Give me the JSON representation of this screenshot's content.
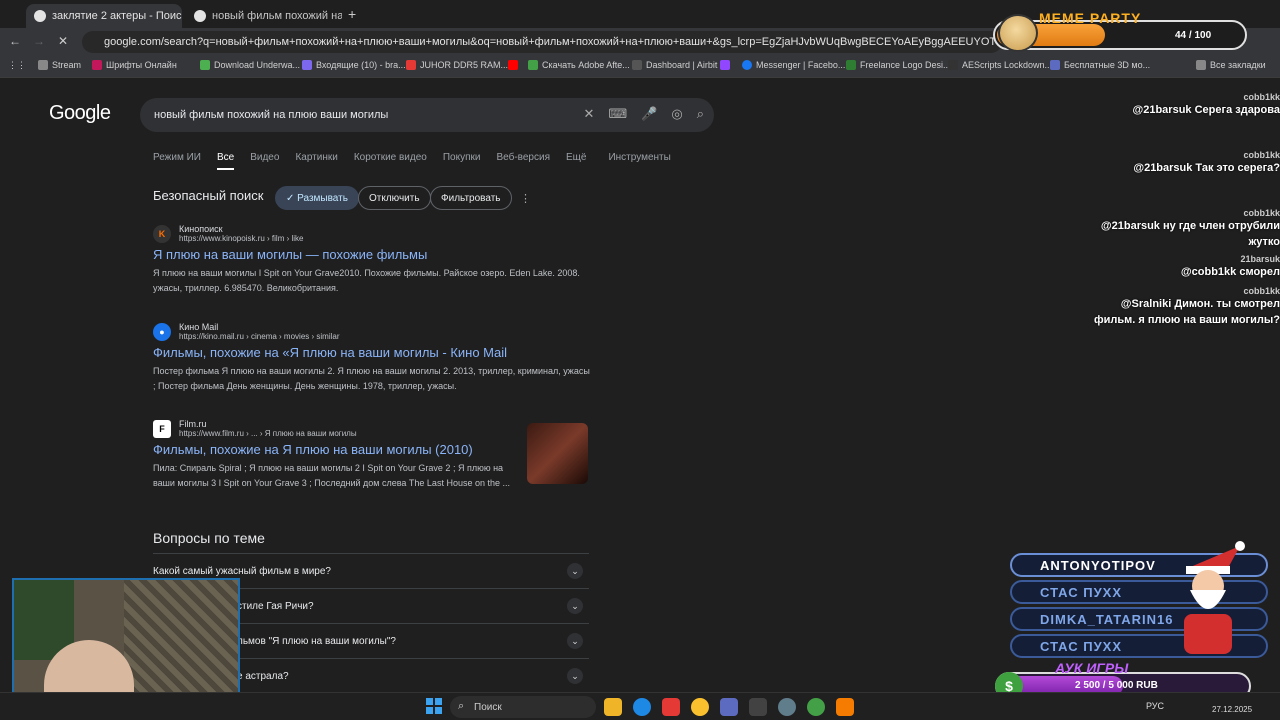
{
  "tabs": [
    {
      "title": "заклятие 2 актеры - Поиск в G"
    },
    {
      "title": "новый фильм похожий на плю"
    }
  ],
  "address": "google.com/search?q=новый+фильм+похожий+на+плюю+ваши+могилы&oq=новый+фильм+похожий+на+плюю+ваши+&gs_lcrp=EgZjaHJvbWUqBwgBECEYoAEyBggAEEUYOTIHCAEQIRigATIHCAIQIRigATIHC",
  "bookmarks": [
    "Stream",
    "Шрифты Онлайн",
    "Download Underwa...",
    "Входящие (10) - bra...",
    "JUHOR DDR5 RAM...",
    "Скачать Adobe Afte...",
    "Dashboard | Airbit",
    "Messenger | Facebo...",
    "Freelance Logo Desi...",
    "AEScripts Lockdown...",
    "Бесплатные 3D мо...",
    "Все закладки"
  ],
  "google": {
    "logo": "Google",
    "query": "новый фильм похожий на плюю ваши могилы",
    "tabs": [
      "Режим ИИ",
      "Все",
      "Видео",
      "Картинки",
      "Короткие видео",
      "Покупки",
      "Веб-версия",
      "Ещё",
      "Инструменты"
    ],
    "safe_search": "Безопасный поиск",
    "safe_options": [
      "Размывать",
      "Отключить",
      "Фильтровать"
    ]
  },
  "results": [
    {
      "site": "Кинопоиск",
      "url": "https://www.kinopoisk.ru › film › like",
      "title": "Я плюю на ваши могилы — похожие фильмы",
      "snippet": "Я плюю на ваши могилы I Spit on Your Grave2010. Похожие фильмы. Райское озеро. Eden Lake. 2008. ужасы, триллер. 6.985470. Великобритания."
    },
    {
      "site": "Кино Mail",
      "url": "https://kino.mail.ru › cinema › movies › similar",
      "title": "Фильмы, похожие на «Я плюю на ваши могилы - Кино Mail",
      "snippet": "Постер фильма Я плюю на ваши могилы 2. Я плюю на ваши могилы 2. 2013, триллер, криминал, ужасы ; Постер фильма День женщины. День женщины. 1978, триллер, ужасы."
    },
    {
      "site": "Film.ru",
      "url": "https://www.film.ru › ... › Я плюю на ваши могилы",
      "title": "Фильмы, похожие на Я плюю на ваши могилы (2010)",
      "snippet": "Пила: Спираль Spiral ; Я плюю на ваши могилы 2 I Spit on Your Grave 2 ; Я плюю на ваши могилы 3 I Spit on Your Grave 3 ; Последний дом слева The Last House on the ..."
    }
  ],
  "questions": {
    "heading": "Вопросы по теме",
    "items": [
      "Какой самый ужасный фильм в мире?",
      "стиле Гая Ричи?",
      "льмов \"Я плюю на ваши могилы\"?",
      "е астрала?"
    ]
  },
  "overlay": {
    "meme_title": "MEME PARTY",
    "meme_count": "44 / 100",
    "meme_progress": 0.44,
    "chat": [
      {
        "user": "cobb1kk",
        "msg": "@21barsuk Серега здарова"
      },
      {
        "user": "cobb1kk",
        "msg": "@21barsuk Так это серега?"
      },
      {
        "user": "cobb1kk",
        "msg": "@21barsuk ну где член отрубили жутко"
      },
      {
        "user": "21barsuk",
        "msg": "@cobb1kk сморел"
      },
      {
        "user": "cobb1kk",
        "msg": "@Sralniki Димон. ты смотрел фильм. я плюю на ваши могилы?"
      }
    ],
    "donors": [
      "ANTONYOTIPOV",
      "СТАС ПУХХ",
      "DIMKA_TATARIN16",
      "СТАС ПУХХ"
    ],
    "auk_title": "АУК ИГРЫ",
    "auk_value": "2 500 / 5 000 RUB",
    "auk_progress": 0.5
  },
  "taskbar": {
    "search": "Поиск",
    "lang": "РУС",
    "date": "27.12.2025"
  }
}
